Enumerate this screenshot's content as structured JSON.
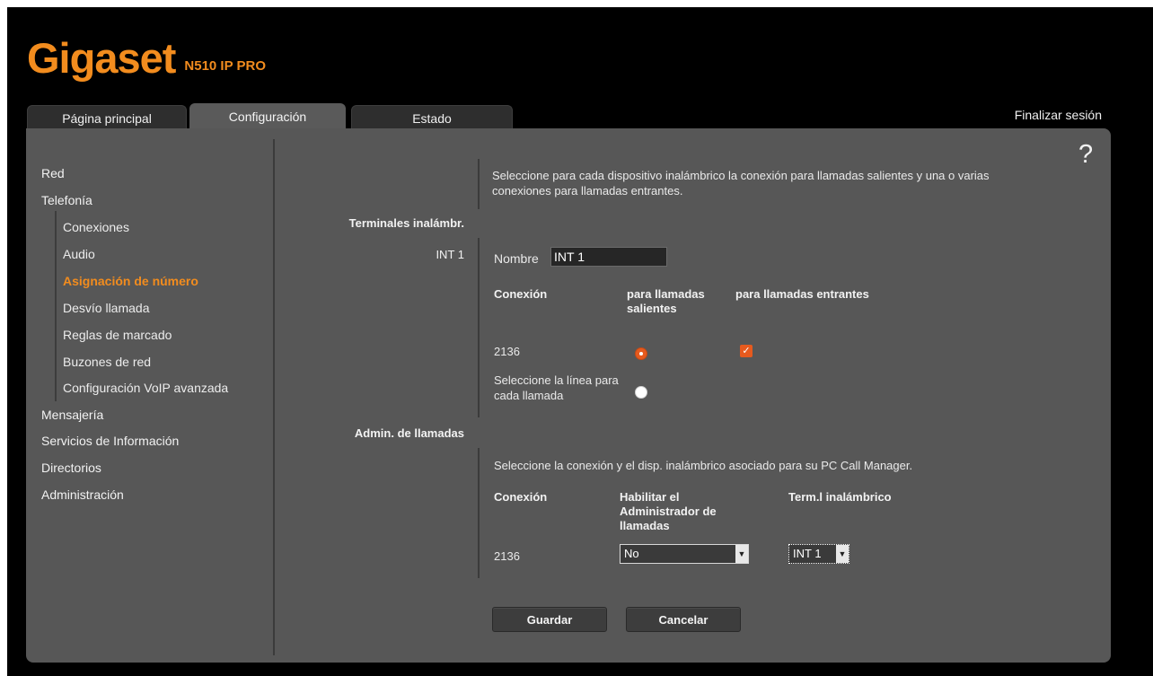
{
  "brand": {
    "name": "Gigaset",
    "model": "N510 IP PRO",
    "color": "#f28c1e"
  },
  "tabs": [
    {
      "label": "Página principal",
      "active": false
    },
    {
      "label": "Configuración",
      "active": true
    },
    {
      "label": "Estado",
      "active": false
    }
  ],
  "logout_label": "Finalizar sesión",
  "help_icon": "?",
  "sidebar": {
    "items": [
      {
        "label": "Red"
      },
      {
        "label": "Telefonía"
      },
      {
        "label": "Conexiones"
      },
      {
        "label": "Audio"
      },
      {
        "label": "Asignación de número"
      },
      {
        "label": "Desvío llamada"
      },
      {
        "label": "Reglas de marcado"
      },
      {
        "label": "Buzones de red"
      },
      {
        "label": "Configuración VoIP avanzada"
      },
      {
        "label": "Mensajería"
      },
      {
        "label": "Servicios de Información"
      },
      {
        "label": "Directorios"
      },
      {
        "label": "Administración"
      }
    ]
  },
  "main": {
    "intro": "Seleccione para cada dispositivo inalámbrico la conexión para llamadas salientes y una o varias conexiones para llamadas entrantes.",
    "handsets_heading": "Terminales inalámbr.",
    "handset_id": "INT 1",
    "name_label": "Nombre",
    "name_value": "INT 1",
    "col_connection": "Conexión",
    "col_outgoing": "para llamadas salientes",
    "col_incoming": "para llamadas entrantes",
    "row_connection": "2136",
    "select_line_label": "Seleccione la línea para cada llamada",
    "call_manager_heading": "Admin. de llamadas",
    "call_manager_intro": "Seleccione la conexión y el disp. inalámbrico asociado para su PC Call Manager.",
    "cm_col_connection": "Conexión",
    "cm_col_enable": "Habilitar el Administrador de llamadas",
    "cm_col_handset": "Term.l inalámbrico",
    "cm_row_connection": "2136",
    "cm_enable_value": "No",
    "cm_handset_value": "INT 1",
    "save_label": "Guardar",
    "cancel_label": "Cancelar"
  },
  "colors": {
    "accent": "#f28c1e",
    "panel": "#575757",
    "radio_selected": "#e65a1e"
  }
}
